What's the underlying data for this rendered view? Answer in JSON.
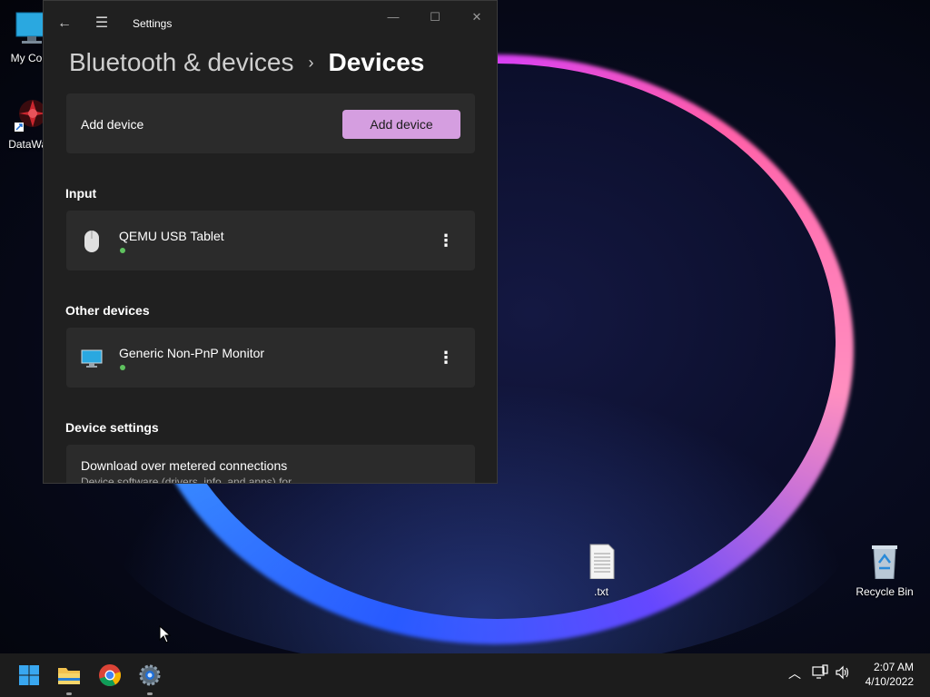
{
  "desktop": {
    "icons": [
      {
        "label": "My Com"
      },
      {
        "label": "DataWag"
      },
      {
        "label": ".txt"
      },
      {
        "label": "Recycle Bin"
      }
    ]
  },
  "window": {
    "title": "Settings",
    "breadcrumb": {
      "parent": "Bluetooth & devices",
      "separator": "›",
      "current": "Devices"
    },
    "add_device_card": {
      "label": "Add device",
      "button": "Add device"
    },
    "sections": {
      "input": {
        "title": "Input",
        "device": "QEMU USB Tablet"
      },
      "other_devices": {
        "title": "Other devices",
        "device": "Generic Non-PnP Monitor"
      },
      "device_settings": {
        "title": "Device settings",
        "setting_label": "Download over metered connections",
        "setting_description": "Device software (drivers, info, and apps) for"
      }
    },
    "colors": {
      "accent": "#d59ee0",
      "status_ok": "#5fc25f",
      "background": "#202020",
      "card": "#2b2b2b"
    }
  },
  "taskbar": {
    "apps": [
      {
        "name": "start-icon"
      },
      {
        "name": "file-explorer-icon"
      },
      {
        "name": "chrome-icon"
      },
      {
        "name": "settings-icon"
      }
    ],
    "clock": {
      "time": "2:07 AM",
      "date": "4/10/2022"
    }
  }
}
